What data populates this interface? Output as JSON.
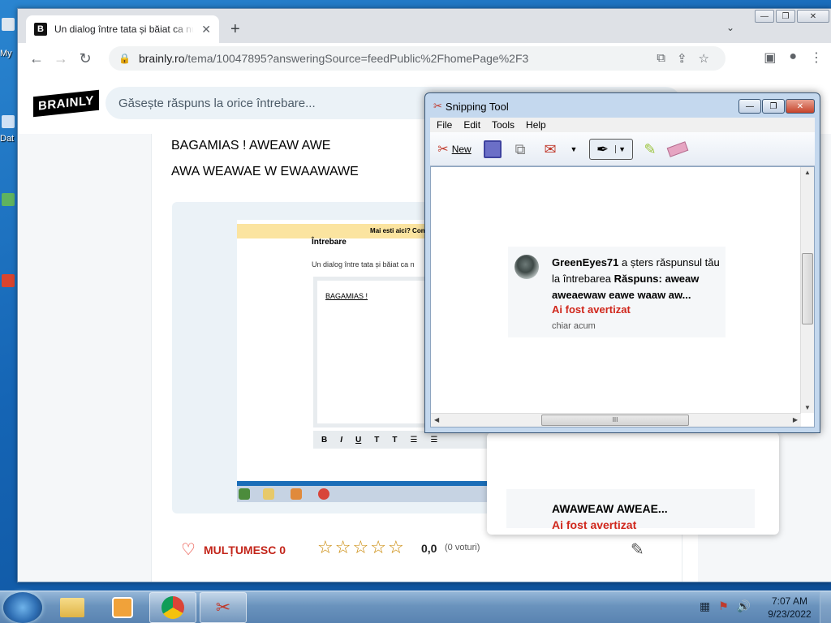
{
  "desktop": {
    "label_1": "My",
    "label_2": "Dat"
  },
  "browser": {
    "tab_title": "Un dialog între tata și băiat ca nu",
    "tab_favicon": "B",
    "tab_close": "✕",
    "new_tab": "+",
    "url_host": "brainly.ro",
    "url_path": "/tema/10047895?answeringSource=feedPublic%2FhomePage%2F3"
  },
  "site": {
    "logo": "BRAINLY",
    "search_placeholder": "Găsește răspuns la orice întrebare...",
    "answer_line1": "BAGAMIAS ! AWEAW AWE",
    "answer_line2": "AWA WEAWAE W EWAAWAWE",
    "attachment": {
      "banner": "Mai esti aici? Continuă să răsp",
      "heading": "Întrebare",
      "subtitle": "Un dialog între tata și băiat ca n",
      "box_text": "BAGAMIAS !",
      "fmt": [
        "B",
        "I",
        "U",
        "T",
        "T",
        "☰",
        "☰"
      ]
    },
    "thanks_label": "MULȚUMESC 0",
    "rating": "0,0",
    "votes": "(0 voturi)",
    "bg_notification": {
      "title_tail": "AWAWEAW AWEAE...",
      "warning": "Ai fost avertizat"
    }
  },
  "snipping_tool": {
    "title": "Snipping Tool",
    "menu": [
      "File",
      "Edit",
      "Tools",
      "Help"
    ],
    "new_label": "New",
    "notification": {
      "user": "GreenEyes71",
      "action": "a șters răspunsul tău",
      "line2_prefix": "la întrebarea",
      "line2_bold": "Răspuns: aweaw",
      "line3": "aweaewaw eawe waaw aw...",
      "warning": "Ai fost avertizat",
      "time": "chiar acum"
    },
    "hscroll_grip": "III"
  },
  "taskbar": {
    "time": "7:07 AM",
    "date": "9/23/2022"
  },
  "colors": {
    "brainly_red": "#d0261b",
    "star": "#c98600",
    "chrome_bar": "#dee1e6"
  }
}
